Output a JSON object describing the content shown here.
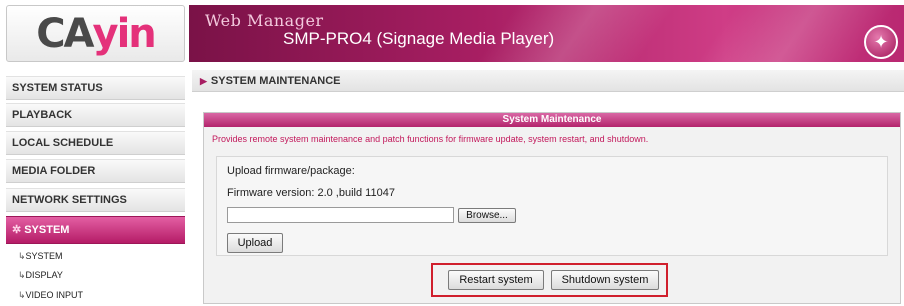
{
  "logo": {
    "text_main": "CA",
    "text_accent": "yin"
  },
  "header": {
    "app_title": "Web Manager",
    "device_title": "SMP-PRO4 (Signage Media Player)",
    "wand_icon": "magic-wand-icon"
  },
  "sidebar": {
    "items": [
      {
        "label": "SYSTEM STATUS"
      },
      {
        "label": "PLAYBACK"
      },
      {
        "label": "LOCAL SCHEDULE"
      },
      {
        "label": "MEDIA FOLDER"
      },
      {
        "label": "NETWORK SETTINGS"
      },
      {
        "label": "SYSTEM",
        "active": true
      }
    ],
    "subitems": [
      {
        "label": "SYSTEM"
      },
      {
        "label": "DISPLAY"
      },
      {
        "label": "VIDEO INPUT"
      }
    ]
  },
  "section": {
    "title": "SYSTEM MAINTENANCE"
  },
  "panel": {
    "title": "System Maintenance",
    "description": "Provides remote system maintenance and patch functions for firmware update, system restart, and shutdown.",
    "upload_label": "Upload firmware/package:",
    "firmware_version": "Firmware version: 2.0 ,build 11047",
    "file_value": "",
    "browse_label": "Browse...",
    "upload_button": "Upload",
    "restart_button": "Restart system",
    "shutdown_button": "Shutdown system"
  },
  "colors": {
    "accent": "#b51c67",
    "highlight_border": "#d01f2d",
    "description_text": "#c2185b"
  }
}
